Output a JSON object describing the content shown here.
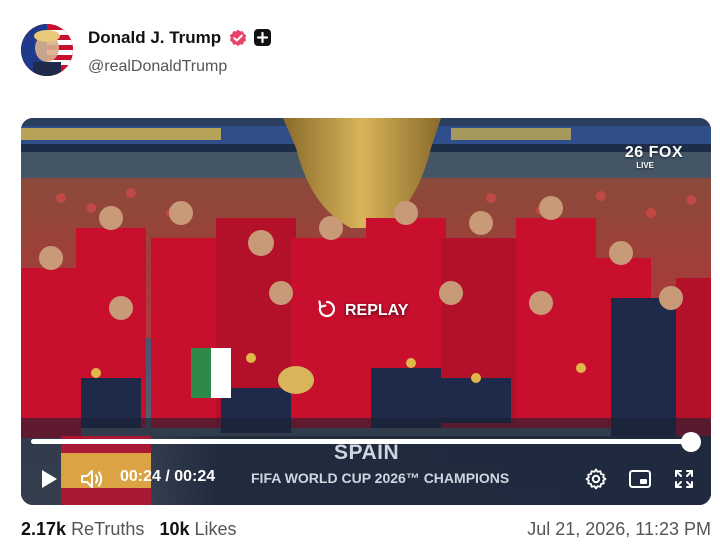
{
  "author": {
    "display_name": "Donald J. Trump",
    "handle": "@realDonaldTrump",
    "verified": true
  },
  "video": {
    "network_logo": "26 FOX",
    "live_tag": "LIVE",
    "replay_label": "REPLAY",
    "time_display": "00:24 / 00:24",
    "progress": 1.0,
    "lower_third": {
      "country": "SPAIN",
      "subtitle": "FIFA WORLD CUP 2026™ CHAMPIONS"
    },
    "controls": {
      "play_icon": "play-icon",
      "volume_icon": "volume-icon",
      "settings_icon": "gear-icon",
      "pip_icon": "picture-in-picture-icon",
      "fullscreen_icon": "fullscreen-icon"
    }
  },
  "stats": {
    "retruths_count": "2.17k",
    "retruths_label": "ReTruths",
    "likes_count": "10k",
    "likes_label": "Likes"
  },
  "timestamp": "Jul 21, 2026, 11:23 PM",
  "colors": {
    "verified": "#e8426b",
    "jersey_red": "#c8102e",
    "jersey_navy": "#1f2a4a"
  }
}
